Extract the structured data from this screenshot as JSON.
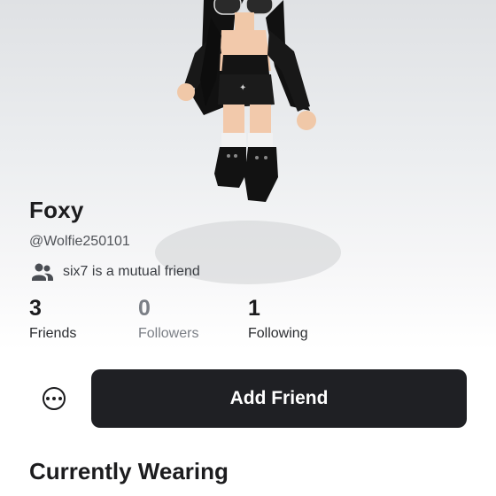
{
  "profile": {
    "display_name": "Foxy",
    "username": "@Wolfie250101",
    "mutual_text": "six7 is a mutual friend"
  },
  "stats": {
    "friends": {
      "count": "3",
      "label": "Friends"
    },
    "followers": {
      "count": "0",
      "label": "Followers"
    },
    "following": {
      "count": "1",
      "label": "Following"
    }
  },
  "actions": {
    "add_friend_label": "Add Friend",
    "more_icon": "ellipsis-circle-icon"
  },
  "sections": {
    "currently_wearing": "Currently Wearing"
  },
  "icons": {
    "mutual": "people-icon"
  },
  "colors": {
    "button_bg": "#1f2024",
    "button_text": "#ffffff",
    "muted_text": "#7b7f86"
  }
}
